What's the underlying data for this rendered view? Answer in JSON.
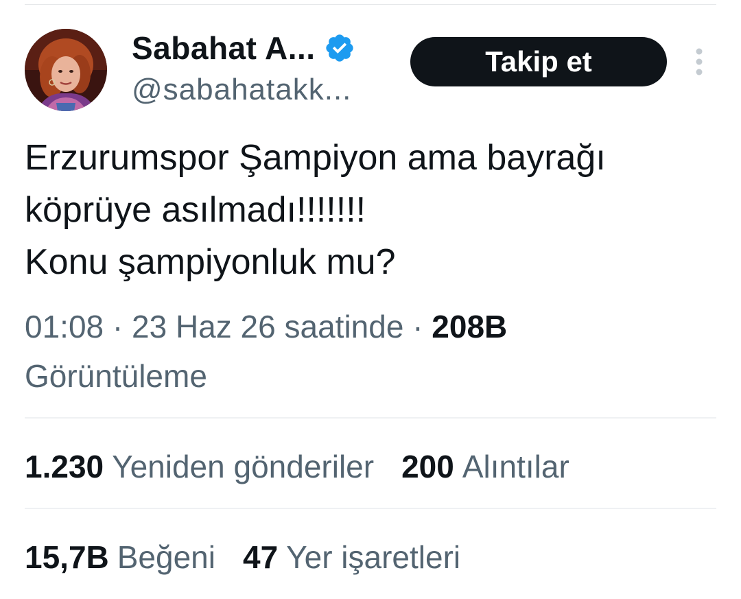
{
  "tweet": {
    "author": {
      "name": "Sabahat A...",
      "handle": "@sabahatakk...",
      "verified_color": "#1d9bf0"
    },
    "follow_label": "Takip et",
    "more_icon": "more-vertical-icon",
    "text_lines": [
      "Erzurumspor Şampiyon ama bayrağı",
      "köprüye asılmadı!!!!!!!",
      "Konu şampiyonluk mu?"
    ],
    "meta": {
      "time": "01:08",
      "separator": "·",
      "date": "23 Haz 26 saatinde",
      "views_count": "208B",
      "views_label": "Görüntüleme"
    },
    "stats": {
      "retweets": {
        "count": "1.230",
        "label": "Yeniden gönderiler"
      },
      "quotes": {
        "count": "200",
        "label": "Alıntılar"
      },
      "likes": {
        "count": "15,7B",
        "label": "Beğeni"
      },
      "bookmarks": {
        "count": "47",
        "label": "Yer işaretleri"
      }
    }
  },
  "colors": {
    "text_primary": "#0f1419",
    "text_secondary": "#536471",
    "follow_button_bg": "#0f1419",
    "divider": "#eff1f3"
  }
}
